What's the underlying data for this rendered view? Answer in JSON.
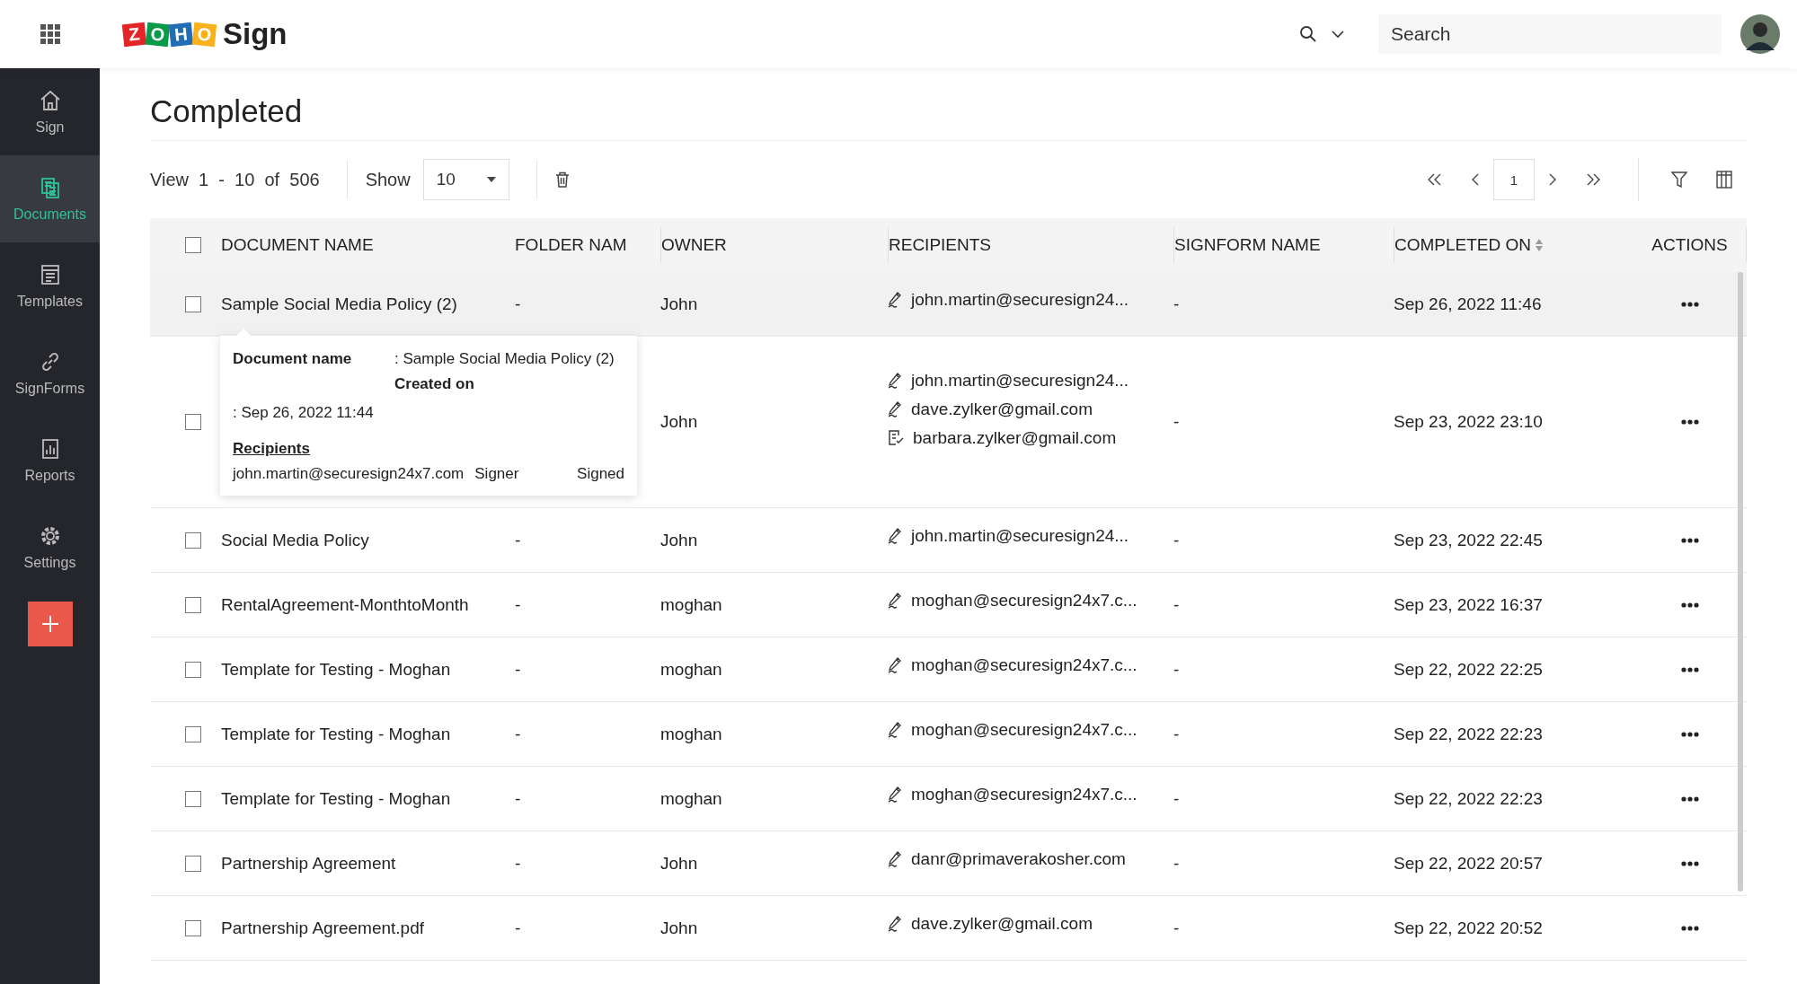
{
  "header": {
    "logo": {
      "letters": [
        {
          "char": "Z",
          "color": "#e42527"
        },
        {
          "char": "O",
          "color": "#089949"
        },
        {
          "char": "H",
          "color": "#226db4"
        },
        {
          "char": "O",
          "color": "#f9b21d"
        }
      ],
      "product": "Sign"
    },
    "search": {
      "placeholder": "Search"
    }
  },
  "sidebar": {
    "items": [
      {
        "label": "Sign",
        "kind": "home",
        "selected": false
      },
      {
        "label": "Documents",
        "kind": "documents",
        "selected": true
      },
      {
        "label": "Templates",
        "kind": "templates",
        "selected": false
      },
      {
        "label": "SignForms",
        "kind": "signforms",
        "selected": false
      },
      {
        "label": "Reports",
        "kind": "reports",
        "selected": false
      },
      {
        "label": "Settings",
        "kind": "settings",
        "selected": false
      }
    ]
  },
  "page_title": "Completed",
  "toolbar": {
    "view_text": "View  1  -  10  of  506",
    "show_label": "Show",
    "page_size": "10",
    "current_page": "1"
  },
  "table": {
    "all_selected": false,
    "columns": [
      {
        "label": "DOCUMENT NAME",
        "sortable": false
      },
      {
        "label": "FOLDER NAM",
        "sortable": false
      },
      {
        "label": "OWNER",
        "sortable": false
      },
      {
        "label": "RECIPIENTS",
        "sortable": false
      },
      {
        "label": "SIGNFORM NAME",
        "sortable": false
      },
      {
        "label": "COMPLETED ON",
        "sortable": true
      },
      {
        "label": "ACTIONS",
        "sortable": false
      }
    ],
    "rows": [
      {
        "selected": false,
        "hovered": true,
        "document_name": "Sample Social Media Policy (2)",
        "folder_name": "-",
        "owner": "John",
        "recipients": [
          {
            "email": "john.martin@securesign24...",
            "kind": "signer"
          }
        ],
        "signform_name": "-",
        "completed_on": "Sep 26, 2022 11:46"
      },
      {
        "selected": false,
        "hovered": false,
        "owner": "John",
        "recipients": [
          {
            "email": "john.martin@securesign24...",
            "kind": "signer"
          },
          {
            "email": "dave.zylker@gmail.com",
            "kind": "signer"
          },
          {
            "email": "barbara.zylker@gmail.com",
            "kind": "reviewer"
          }
        ],
        "signform_name": "-",
        "completed_on": "Sep 23, 2022 23:10"
      },
      {
        "selected": false,
        "hovered": false,
        "document_name": "Social Media Policy",
        "folder_name": "-",
        "owner": "John",
        "recipients": [
          {
            "email": "john.martin@securesign24...",
            "kind": "signer"
          }
        ],
        "signform_name": "-",
        "completed_on": "Sep 23, 2022 22:45"
      },
      {
        "selected": false,
        "hovered": false,
        "document_name": "RentalAgreement-MonthtoMonth",
        "folder_name": "-",
        "owner": "moghan",
        "recipients": [
          {
            "email": "moghan@securesign24x7.c...",
            "kind": "signer"
          }
        ],
        "signform_name": "-",
        "completed_on": "Sep 23, 2022 16:37"
      },
      {
        "selected": false,
        "hovered": false,
        "document_name": "Template for Testing - Moghan",
        "folder_name": "-",
        "owner": "moghan",
        "recipients": [
          {
            "email": "moghan@securesign24x7.c...",
            "kind": "signer"
          }
        ],
        "signform_name": "-",
        "completed_on": "Sep 22, 2022 22:25"
      },
      {
        "selected": false,
        "hovered": false,
        "document_name": "Template for Testing - Moghan",
        "folder_name": "-",
        "owner": "moghan",
        "recipients": [
          {
            "email": "moghan@securesign24x7.c...",
            "kind": "signer"
          }
        ],
        "signform_name": "-",
        "completed_on": "Sep 22, 2022 22:23"
      },
      {
        "selected": false,
        "hovered": false,
        "document_name": "Template for Testing - Moghan",
        "folder_name": "-",
        "owner": "moghan",
        "recipients": [
          {
            "email": "moghan@securesign24x7.c...",
            "kind": "signer"
          }
        ],
        "signform_name": "-",
        "completed_on": "Sep 22, 2022 22:23"
      },
      {
        "selected": false,
        "hovered": false,
        "document_name": "Partnership Agreement",
        "folder_name": "-",
        "owner": "John",
        "recipients": [
          {
            "email": "danr@primaverakosher.com",
            "kind": "signer"
          }
        ],
        "signform_name": "-",
        "completed_on": "Sep 22, 2022 20:57"
      },
      {
        "selected": false,
        "hovered": false,
        "document_name": "Partnership Agreement.pdf",
        "folder_name": "-",
        "owner": "John",
        "recipients": [
          {
            "email": "dave.zylker@gmail.com",
            "kind": "signer"
          }
        ],
        "signform_name": "-",
        "completed_on": "Sep 22, 2022 20:52"
      }
    ]
  },
  "tooltip": {
    "document_name_label": "Document name",
    "document_name": ":  Sample Social Media Policy (2)",
    "created_on_label": "Created on",
    "created_on": ":  Sep 26, 2022 11:44",
    "recipients_label": "Recipients",
    "recipients": [
      {
        "email": "john.martin@securesign24x7.com",
        "role": "Signer",
        "status": "Signed"
      }
    ]
  }
}
